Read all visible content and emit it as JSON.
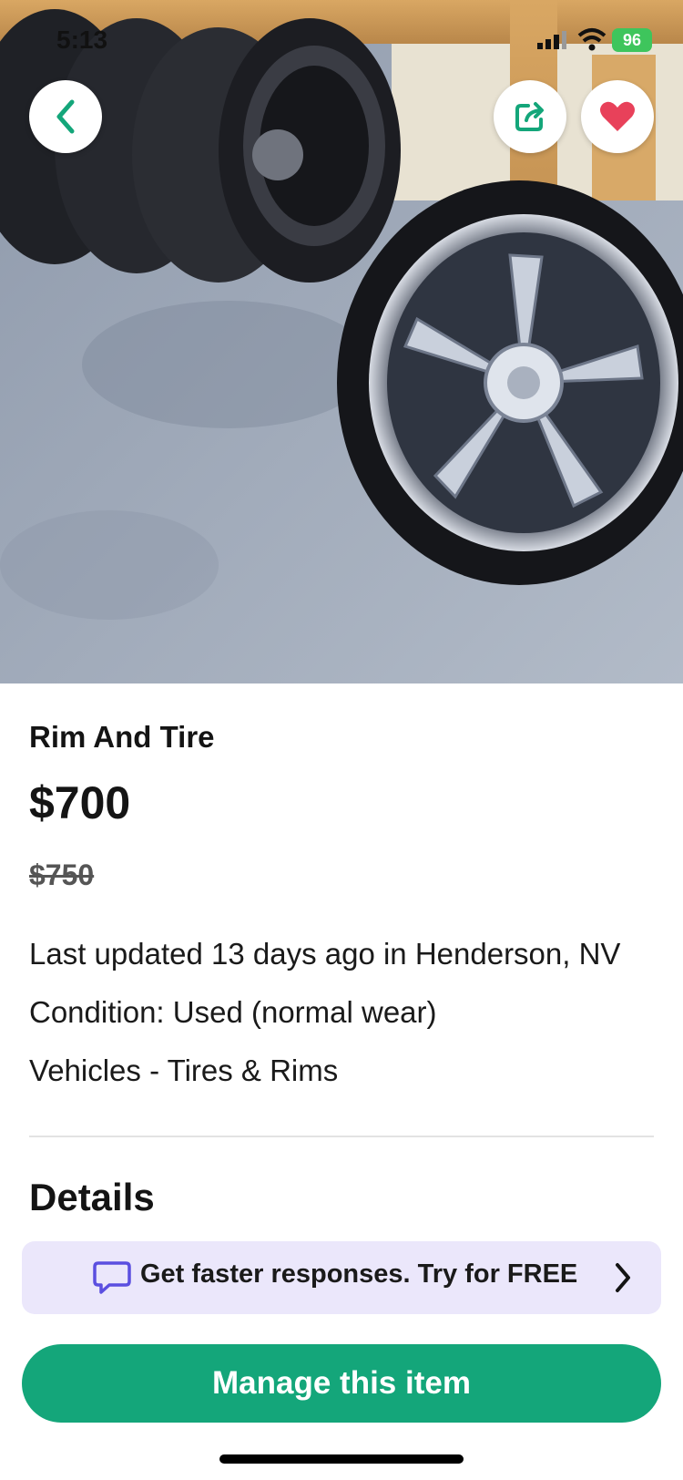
{
  "status_bar": {
    "time": "5:13",
    "battery": "96"
  },
  "listing": {
    "title": "Rim And Tire",
    "price": "$700",
    "original_price": "$750",
    "last_updated": "Last updated 13 days ago in Henderson, NV",
    "condition": "Condition: Used (normal wear)",
    "category": "Vehicles - Tires & Rims"
  },
  "sections": {
    "details_heading": "Details"
  },
  "promo": {
    "text": "Get faster responses. Try for FREE"
  },
  "actions": {
    "manage_label": "Manage this item"
  },
  "icons": {
    "back": "chevron-left-icon",
    "share": "share-icon",
    "favorite": "heart-icon",
    "promo": "chat-bubble-icon",
    "promo_arrow": "chevron-right-icon"
  },
  "colors": {
    "accent": "#14a67a",
    "heart": "#e8415a",
    "promo_bg": "#ebe7fb",
    "promo_icon": "#5b4fe0"
  }
}
